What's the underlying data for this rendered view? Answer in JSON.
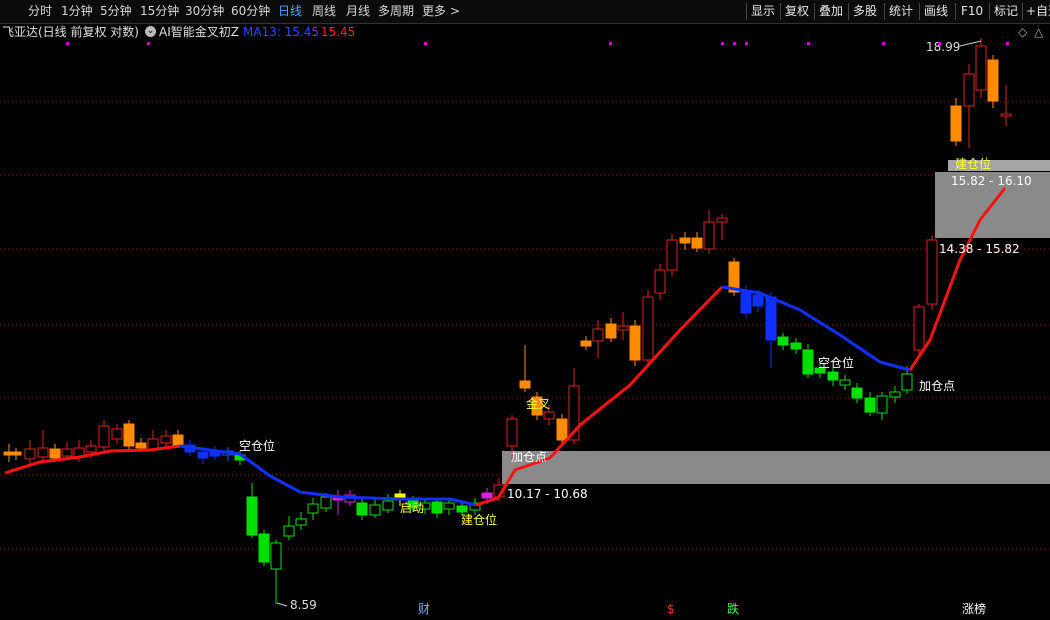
{
  "toolbar": {
    "left": [
      "分时",
      "1分钟",
      "5分钟",
      "15分钟",
      "30分钟",
      "60分钟",
      "日线",
      "周线",
      "月线",
      "多周期",
      "更多"
    ],
    "right": [
      "显示",
      "复权",
      "叠加",
      "多股",
      "统计",
      "画线",
      "F10",
      "标记",
      "+自选"
    ]
  },
  "info": {
    "stock": "飞亚达(日线 前复权 对数)",
    "indicator": "AI智能金叉初Z",
    "ma_label": "MA13: 15.45",
    "ma_value": ": 15.45"
  },
  "chart_data": {
    "type": "candlestick",
    "ylim": [
      8.59,
      18.99
    ],
    "price_marks": {
      "low": "8.59",
      "high": "18.99"
    },
    "zones": [
      {
        "label": "加仓点",
        "range": "10.17 - 10.68"
      },
      {
        "label": "建仓位",
        "range": "14.38 - 15.82"
      },
      {
        "label": "",
        "range": "15.82 - 16.10"
      }
    ],
    "signals": [
      "空仓位",
      "启动",
      "建仓位",
      "金叉",
      "空仓位",
      "加仓点",
      "建仓位"
    ],
    "events": [
      "财",
      "$",
      "跌",
      "涨榜"
    ]
  },
  "colors": {
    "up": "#ff8c00",
    "down_red": "#e02020",
    "green": "#00e000",
    "blue": "#1030ff",
    "line_red": "#ff1010",
    "zone": "#8a8a8a",
    "magenta": "#d000d0"
  }
}
